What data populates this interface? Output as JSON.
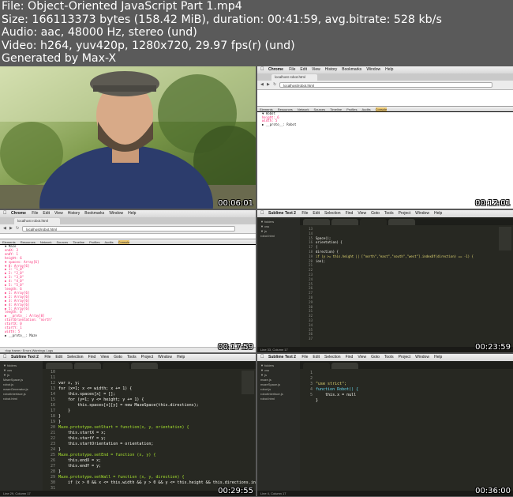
{
  "header": {
    "file": "File: Object-Oriented JavaScript Part 1.mp4",
    "size": "Size: 166113373 bytes (158.42 MiB), duration: 00:41:59, avg.bitrate: 528 kb/s",
    "audio": "Audio: aac, 48000 Hz, stereo (und)",
    "video": "Video: h264, yuv420p, 1280x720, 29.97 fps(r) (und)",
    "generated": "Generated by Max-X"
  },
  "thumbs": [
    {
      "timestamp": "00:06:01"
    },
    {
      "timestamp": "00:12:01",
      "app": "Chrome",
      "menus": [
        "File",
        "Edit",
        "View",
        "History",
        "Bookmarks",
        "Window",
        "Help"
      ],
      "tab": "localhost robot.html",
      "url": "localhost/robot.html",
      "devtools": [
        "Elements",
        "Resources",
        "Network",
        "Sources",
        "Timeline",
        "Profiles",
        "Audits",
        "Console"
      ],
      "console": [
        "▼ Robot",
        "  height: 6",
        "  width: 5",
        "  ▶ __proto__: Robot"
      ]
    },
    {
      "timestamp": "00:17:59",
      "app": "Chrome",
      "menus": [
        "File",
        "Edit",
        "View",
        "History",
        "Bookmarks",
        "Window",
        "Help"
      ],
      "tab": "localhost robot.html",
      "url": "localhost/robot.html",
      "devtools": [
        "Elements",
        "Resources",
        "Network",
        "Sources",
        "Timeline",
        "Profiles",
        "Audits",
        "Console"
      ],
      "console": [
        "▼ Maze",
        "  endX: 3",
        "  endY: 1",
        "  height: 6",
        "  ▼ spaces: Array[6]",
        "    ▼ 0: Array[6]",
        "      ▶ 1: \"1_0\"",
        "      ▶ 2: \"2_0\"",
        "      ▶ 3: \"3_0\"",
        "      ▶ 4: \"4_0\"",
        "      ▶ 5: \"5_0\"",
        "      length: 6",
        "    ▶ 1: Array[6]",
        "    ▶ 2: Array[6]",
        "    ▶ 3: Array[6]",
        "    ▶ 4: Array[6]",
        "    ▶ 5: Array[6]",
        "    length: 6",
        "  ▶ __proto__: Array[0]",
        "  startOrientation: \"north\"",
        "  startX: 0",
        "  startY: 1",
        "  width: 5",
        "  ▶ __proto__: Maze"
      ],
      "statusbar": "<top frame>   Errors  Warnings  Logs"
    },
    {
      "timestamp": "00:23:59",
      "app": "Sublime Text 2",
      "menus": [
        "File",
        "Edit",
        "Selection",
        "Find",
        "View",
        "Goto",
        "Tools",
        "Project",
        "Window",
        "Help"
      ],
      "sidebar": [
        "▼ folders",
        "  ▼ css",
        "  ▼ js",
        "    robot.html"
      ],
      "lines": [
        "13",
        "14",
        "15",
        "16",
        "17",
        "18",
        "19",
        "20",
        "21",
        "22",
        "23",
        "24",
        "25",
        "26",
        "27",
        "28",
        "29",
        "30",
        "31",
        "32",
        "33",
        "34",
        "35",
        "36",
        "37"
      ],
      "code": [
        "",
        "",
        "",
        "",
        "",
        "",
        "Space();",
        "",
        "",
        "",
        "",
        "orientation) {",
        "",
        "",
        "",
        "",
        "{",
        "",
        "",
        "",
        "",
        "",
        "direction) {",
        "if (y >= this.height || [\"north\",\"east\",\"south\",\"west\"].indexOf(direction) == -1) {",
        "ion);"
      ],
      "status": "Line 33, Column 17"
    },
    {
      "timestamp": "00:29:55",
      "app": "Sublime Text 2",
      "menus": [
        "File",
        "Edit",
        "Selection",
        "Find",
        "View",
        "Goto",
        "Tools",
        "Project",
        "Window",
        "Help"
      ],
      "sidebar": [
        "▼ folders",
        "  ▼ css",
        "  ▼ js",
        "    MazeSpace.js",
        "    robot.js",
        "    mazeGenerator.js",
        "    robotInterface.js",
        "    robot.html"
      ],
      "lines": [
        "10",
        "11",
        "12",
        "13",
        "14",
        "15",
        "16",
        "17",
        "18",
        "19",
        "20",
        "21",
        "22",
        "23",
        "24",
        "25",
        "26",
        "27",
        "28",
        "29",
        "30",
        "31",
        "32",
        "33",
        "34",
        "35",
        "36",
        "37",
        "38",
        "39",
        "40"
      ],
      "code": [
        "",
        "var x, y;",
        "for (x=1; x <= width; x += 1) {",
        "    this.spaces[x] = [];",
        "    for (y=1; y <= height; y += 1) {",
        "        this.spaces[x][y] = new MazeSpace(this.directions);",
        "    }",
        "}",
        "}",
        "",
        "Maze.prototype.setStart = function(x, y, orientation) {",
        "    this.startX = x;",
        "    this.startY = y;",
        "    this.startOrientation = orientation;",
        "}",
        "",
        "Maze.prototype.setEnd = function (x, y) {",
        "    this.endX = x;",
        "    this.endY = y;",
        "}",
        "",
        "Maze.prototype.setWall = function (x, y, direction) {",
        "    if (x > 0 && x <= this.width && y > 0 && y <= this.height && this.directions.in",
        "        this.spaces[x][y].setWall(direction);",
        "        return true;",
        "    }",
        "    return false;"
      ],
      "status": "Line 29, Column 17"
    },
    {
      "timestamp": "00:36:00",
      "app": "Sublime Text 2",
      "menus": [
        "File",
        "Edit",
        "Selection",
        "Find",
        "View",
        "Goto",
        "Tools",
        "Project",
        "Window",
        "Help"
      ],
      "sidebar": [
        "▼ folders",
        "  ▼ css",
        "  ▼ js",
        "    maze.js",
        "    mazeSpace.js",
        "    robot.js",
        "    robotInterface.js",
        "    robot.html"
      ],
      "lines": [
        "1",
        "2",
        "3",
        "4",
        "5"
      ],
      "code": [
        "\"use strict\";",
        "",
        "function Robot() {",
        "    this.x = null",
        "}"
      ],
      "status": "Line 4, Column 17"
    }
  ],
  "colors": {
    "sublime_bg": "#272822",
    "keyword": "#f92672",
    "string": "#e6db74",
    "number": "#ae81ff"
  }
}
